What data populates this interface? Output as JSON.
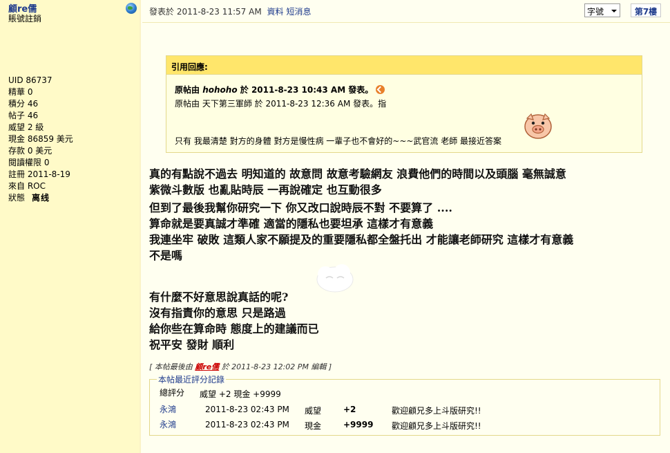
{
  "author": {
    "name": "顧re儒",
    "sub": "賬號註銷",
    "stats": [
      "UID 86737",
      "精華 0",
      "積分 46",
      "帖子 46",
      "威望 2 級",
      "現金 86859 美元",
      "存款 0 美元",
      "閱讀權限 0",
      "註冊 2011-8-19",
      "來自 ROC"
    ],
    "status_label": "狀態",
    "status_value": "离线"
  },
  "header": {
    "posted": "發表於 2011-8-23 11:57 AM",
    "profile_link": "資料",
    "pm_link": "短消息",
    "font_select": "字號",
    "floor": "第7樓"
  },
  "quote": {
    "title": "引用回應:",
    "orig_prefix": "原帖由",
    "orig_user": "hohoho",
    "orig_suffix": "於 2011-8-23 10:43 AM 發表。",
    "line2": "原帖由 天下第三軍師 於 2011-8-23 12:36 AM 發表。指",
    "line3": "只有 我最清楚 對方的身體 對方是慢性病 一輩子也不會好的~~~武官流 老師 最接近答案"
  },
  "post": {
    "lines": [
      "真的有點說不過去 明知道的 故意問 故意考驗網友 浪費他們的時間以及頭腦 毫無誠意",
      "紫微斗數版 也亂貼時辰 一再說確定 也互動很多",
      "但到了最後我幫你研究一下 你又改口說時辰不對 不要算了 ....",
      "算命就是要真誠才準確 適當的隱私也要坦承 這樣才有意義",
      "我連坐牢 破敗 這類人家不願提及的重要隱私都全盤托出 才能讓老師研究 這樣才有意義",
      "不是嗎",
      "有什麼不好意思說真話的呢?",
      "沒有指責你的意思 只是路過",
      "給你些在算命時 態度上的建議而已",
      "祝平安 發財 順利"
    ]
  },
  "edit_note": {
    "prefix": "[ 本帖最後由",
    "user": "顧re儒",
    "suffix": "於 2011-8-23 12:02 PM 編輯 ]"
  },
  "rating": {
    "legend": "本帖最近評分記錄",
    "total_label": "總評分",
    "total_value": "威望 +2 現金 +9999",
    "rows": [
      {
        "user": "永鴻",
        "time": "2011-8-23 02:43 PM",
        "field": "威望",
        "amount": "+2",
        "reason": "歡迎顧兄多上斗版研究!!"
      },
      {
        "user": "永鴻",
        "time": "2011-8-23 02:43 PM",
        "field": "現金",
        "amount": "+9999",
        "reason": "歡迎顧兄多上斗版研究!!"
      }
    ]
  }
}
